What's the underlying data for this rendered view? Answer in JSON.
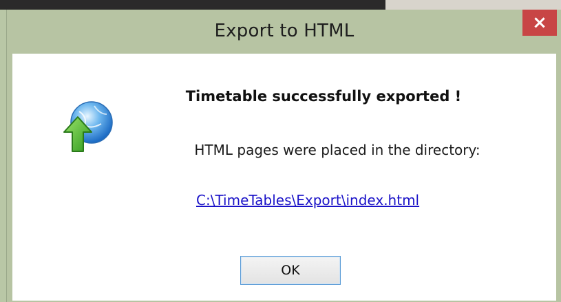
{
  "window": {
    "title": "Export to HTML",
    "close_label": "×"
  },
  "icon": {
    "name": "globe-upload-icon"
  },
  "content": {
    "headline": "Timetable successfully exported !",
    "message": "HTML pages were placed in the directory:",
    "path": "C:\\TimeTables\\Export\\index.html"
  },
  "buttons": {
    "ok_label": "OK"
  },
  "colors": {
    "frame": "#b7c4a3",
    "close": "#c84545",
    "link": "#1a12c8",
    "button_border": "#5a9bd6"
  }
}
